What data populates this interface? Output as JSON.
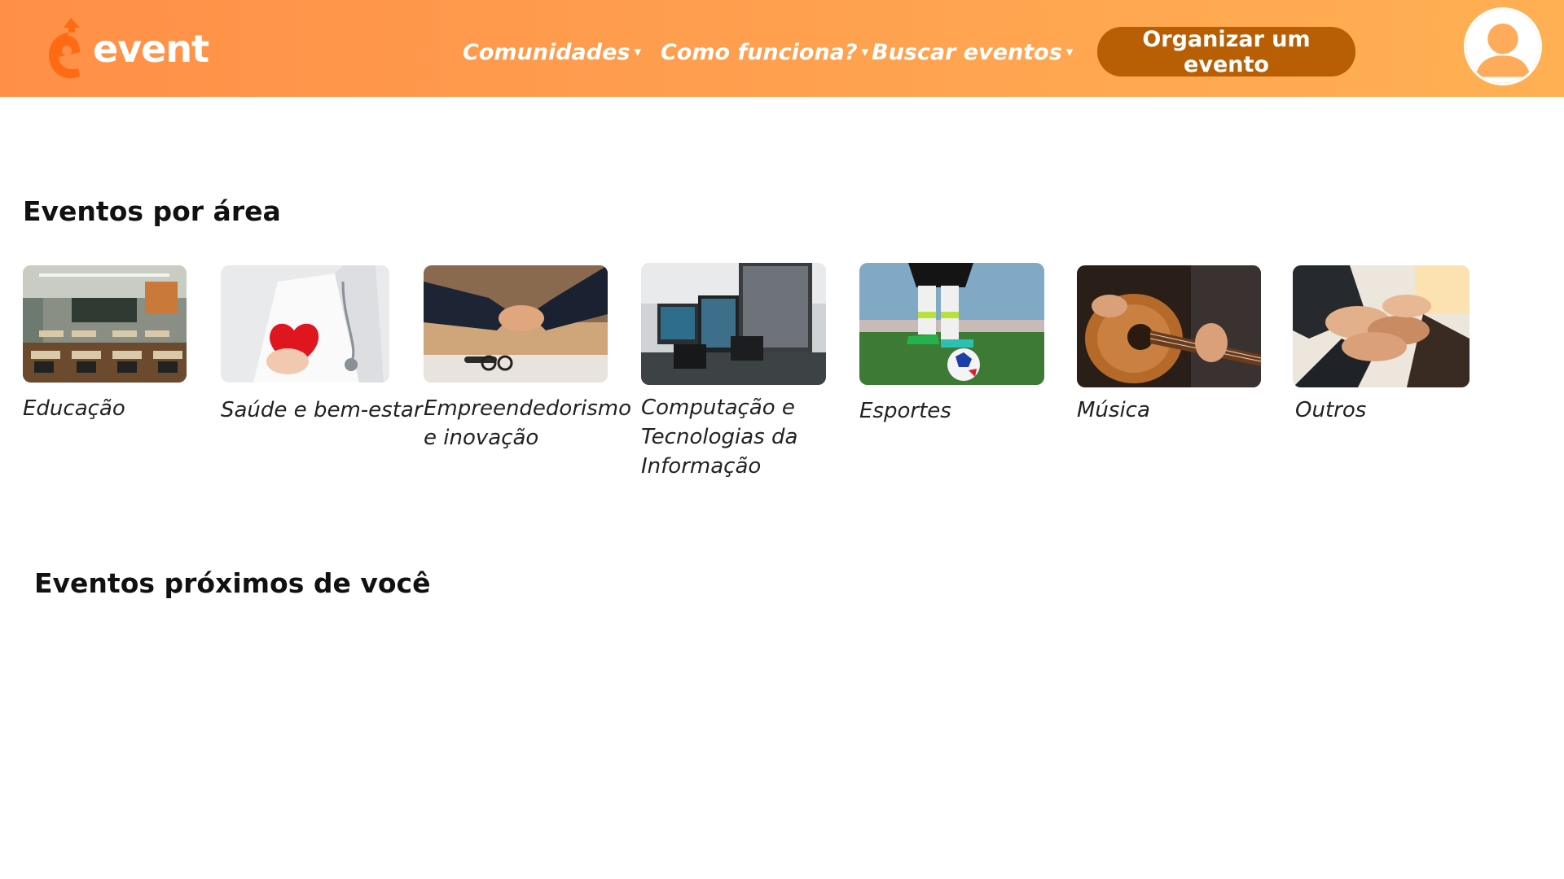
{
  "brand": {
    "name": "event",
    "accent": "#ff9a4d",
    "button_color": "#b85f05"
  },
  "nav": {
    "items": [
      {
        "label": "Comunidades",
        "caret": "▾"
      },
      {
        "label": "Como funciona?",
        "caret": "▾"
      },
      {
        "label": "Buscar eventos",
        "caret": "▾"
      }
    ],
    "cta_label": "Organizar um evento",
    "avatar_icon": "user-avatar-icon"
  },
  "sections": {
    "areas_title": "Eventos por área",
    "nearby_title": "Eventos próximos de você"
  },
  "categories": [
    {
      "label": "Educação",
      "image": "classroom"
    },
    {
      "label": "Saúde e bem-estar",
      "image": "doctor-heart"
    },
    {
      "label": "Empreendedorismo e inovação",
      "image": "handshake"
    },
    {
      "label": "Computação e Tecnologias da Informação",
      "image": "computers"
    },
    {
      "label": "Esportes",
      "image": "soccer"
    },
    {
      "label": "Música",
      "image": "guitar"
    },
    {
      "label": "Outros",
      "image": "joined-hands"
    }
  ]
}
